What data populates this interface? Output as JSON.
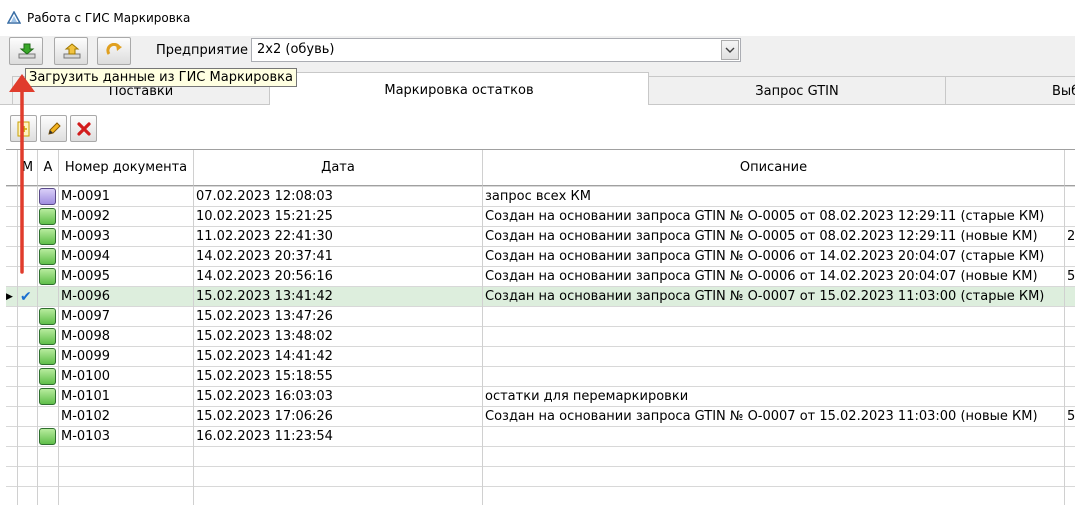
{
  "window": {
    "title": "Работа с ГИС Маркировка"
  },
  "toolbar": {
    "buttons": [
      {
        "name": "download-from-gis-button",
        "icon": "download-green-icon"
      },
      {
        "name": "upload-to-gis-button",
        "icon": "upload-green-icon"
      },
      {
        "name": "refresh-button",
        "icon": "refresh-arrow-icon"
      }
    ],
    "enterprise_label": "Предприятие",
    "enterprise_value": "2x2 (обувь)"
  },
  "tooltip": {
    "text": "Загрузить данные из ГИС Маркировка"
  },
  "tabs": [
    {
      "label": "Поставки",
      "active": false
    },
    {
      "label": "Маркировка остатков",
      "active": true
    },
    {
      "label": "Запрос GTIN",
      "active": false
    },
    {
      "label": "Выб",
      "active": false
    }
  ],
  "sub_toolbar": [
    {
      "name": "add-button",
      "icon": "add-doc-icon"
    },
    {
      "name": "edit-button",
      "icon": "pencil-icon"
    },
    {
      "name": "delete-button",
      "icon": "red-x-icon"
    }
  ],
  "grid": {
    "columns": [
      "М",
      "А",
      "Номер документа",
      "Дата",
      "Описание"
    ],
    "selected_row": 5,
    "rows": [
      {
        "a": "purple",
        "number": "М-0091",
        "date": "07.02.2023 12:08:03",
        "desc": "запрос всех КМ",
        "extra": ""
      },
      {
        "a": "green",
        "number": "М-0092",
        "date": "10.02.2023 15:21:25",
        "desc": "Создан на основании запроса GTIN № О-0005 от 08.02.2023 12:29:11 (старые КМ)",
        "extra": ""
      },
      {
        "a": "green",
        "number": "М-0093",
        "date": "11.02.2023 22:41:30",
        "desc": "Создан на основании запроса GTIN № О-0005 от 08.02.2023 12:29:11 (новые КМ)",
        "extra": "2"
      },
      {
        "a": "green",
        "number": "М-0094",
        "date": "14.02.2023 20:37:41",
        "desc": "Создан на основании запроса GTIN № О-0006 от 14.02.2023 20:04:07 (старые КМ)",
        "extra": ""
      },
      {
        "a": "green",
        "number": "М-0095",
        "date": "14.02.2023 20:56:16",
        "desc": "Создан на основании запроса GTIN № О-0006 от 14.02.2023 20:04:07 (новые КМ)",
        "extra": "5"
      },
      {
        "a": "",
        "m_check": true,
        "number": "М-0096",
        "date": "15.02.2023 13:41:42",
        "desc": "Создан на основании запроса GTIN № О-0007 от 15.02.2023 11:03:00 (старые КМ)",
        "extra": ""
      },
      {
        "a": "green",
        "number": "М-0097",
        "date": "15.02.2023 13:47:26",
        "desc": "",
        "extra": ""
      },
      {
        "a": "green",
        "number": "М-0098",
        "date": "15.02.2023 13:48:02",
        "desc": "",
        "extra": ""
      },
      {
        "a": "green",
        "number": "М-0099",
        "date": "15.02.2023 14:41:42",
        "desc": "",
        "extra": ""
      },
      {
        "a": "green",
        "number": "М-0100",
        "date": "15.02.2023 15:18:55",
        "desc": "",
        "extra": ""
      },
      {
        "a": "green",
        "number": "М-0101",
        "date": "15.02.2023 16:03:03",
        "desc": "остатки для перемаркировки",
        "extra": ""
      },
      {
        "a": "",
        "number": "М-0102",
        "date": "15.02.2023 17:06:26",
        "desc": "Создан на основании запроса GTIN № О-0007 от 15.02.2023 11:03:00 (новые КМ)",
        "extra": "5"
      },
      {
        "a": "green",
        "number": "М-0103",
        "date": "16.02.2023 11:23:54",
        "desc": "",
        "extra": ""
      }
    ]
  },
  "annotation": {
    "arrow_color": "#e03c2c"
  },
  "colors": {
    "selected_row": "#ddeedd",
    "status_green": "#5fbe4a",
    "status_purple": "#a08ee0",
    "check_blue": "#1a6fd0"
  }
}
